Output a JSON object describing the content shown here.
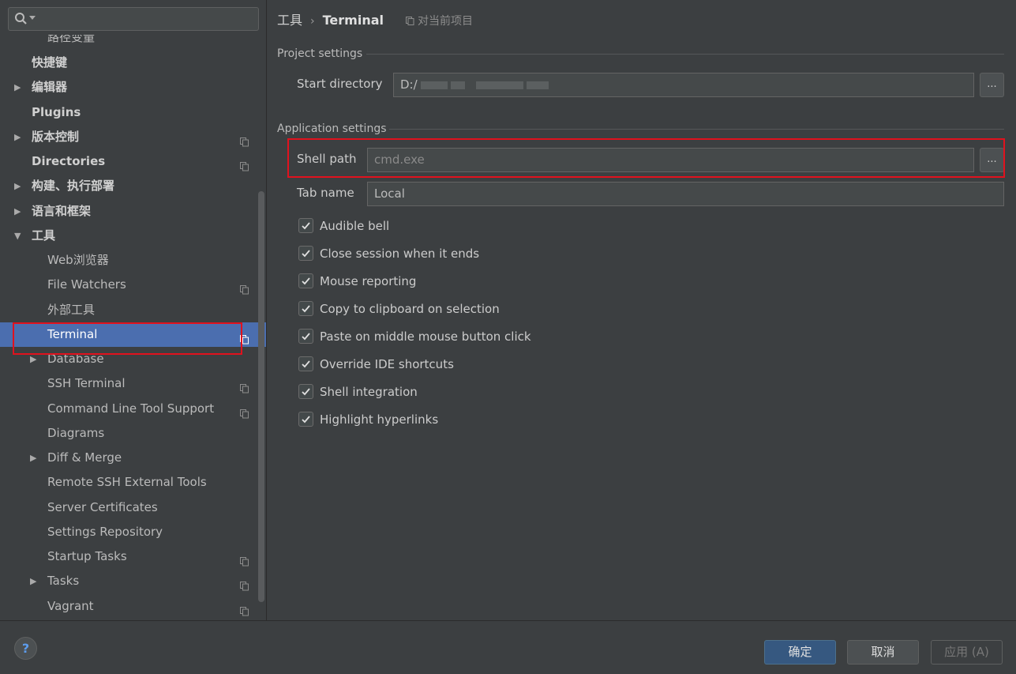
{
  "colors": {
    "background": "#3c3f41",
    "selection": "#4b6eaf",
    "highlight_box": "#e0121e",
    "primary_button": "#365880"
  },
  "sidebar": {
    "search": {
      "value": "",
      "icon": "search-icon"
    },
    "cut_item_label": "路径变量",
    "items": [
      {
        "label": "快捷键",
        "bold": true,
        "level": 0,
        "expandable": false,
        "project_icon": false
      },
      {
        "label": "编辑器",
        "bold": true,
        "level": 0,
        "expandable": true,
        "expanded": false,
        "project_icon": false
      },
      {
        "label": "Plugins",
        "bold": true,
        "level": 0,
        "expandable": false,
        "project_icon": false
      },
      {
        "label": "版本控制",
        "bold": true,
        "level": 0,
        "expandable": true,
        "expanded": false,
        "project_icon": true
      },
      {
        "label": "Directories",
        "bold": true,
        "level": 0,
        "expandable": false,
        "project_icon": true
      },
      {
        "label": "构建、执行部署",
        "bold": true,
        "level": 0,
        "expandable": true,
        "expanded": false,
        "project_icon": false
      },
      {
        "label": "语言和框架",
        "bold": true,
        "level": 0,
        "expandable": true,
        "expanded": false,
        "project_icon": false
      },
      {
        "label": "工具",
        "bold": true,
        "level": 0,
        "expandable": true,
        "expanded": true,
        "project_icon": false
      },
      {
        "label": "Web浏览器",
        "bold": false,
        "level": 1,
        "expandable": false,
        "project_icon": false
      },
      {
        "label": "File Watchers",
        "bold": false,
        "level": 1,
        "expandable": false,
        "project_icon": true
      },
      {
        "label": "外部工具",
        "bold": false,
        "level": 1,
        "expandable": false,
        "project_icon": false
      },
      {
        "label": "Terminal",
        "bold": false,
        "level": 1,
        "expandable": false,
        "project_icon": true,
        "selected": true
      },
      {
        "label": "Database",
        "bold": false,
        "level": 1,
        "expandable": true,
        "expanded": false,
        "project_icon": false
      },
      {
        "label": "SSH Terminal",
        "bold": false,
        "level": 1,
        "expandable": false,
        "project_icon": true
      },
      {
        "label": "Command Line Tool Support",
        "bold": false,
        "level": 1,
        "expandable": false,
        "project_icon": true
      },
      {
        "label": "Diagrams",
        "bold": false,
        "level": 1,
        "expandable": false,
        "project_icon": false
      },
      {
        "label": "Diff & Merge",
        "bold": false,
        "level": 1,
        "expandable": true,
        "expanded": false,
        "project_icon": false
      },
      {
        "label": "Remote SSH External Tools",
        "bold": false,
        "level": 1,
        "expandable": false,
        "project_icon": false
      },
      {
        "label": "Server Certificates",
        "bold": false,
        "level": 1,
        "expandable": false,
        "project_icon": false
      },
      {
        "label": "Settings Repository",
        "bold": false,
        "level": 1,
        "expandable": false,
        "project_icon": false
      },
      {
        "label": "Startup Tasks",
        "bold": false,
        "level": 1,
        "expandable": false,
        "project_icon": true
      },
      {
        "label": "Tasks",
        "bold": false,
        "level": 1,
        "expandable": true,
        "expanded": false,
        "project_icon": true
      },
      {
        "label": "Vagrant",
        "bold": false,
        "level": 1,
        "expandable": false,
        "project_icon": true
      }
    ]
  },
  "breadcrumb": {
    "parent": "工具",
    "separator": "›",
    "current": "Terminal",
    "scope_label": "对当前项目",
    "scope_icon": "project-scope-icon"
  },
  "project_settings": {
    "title": "Project settings",
    "start_directory": {
      "label": "Start directory",
      "value": "D:/",
      "browse": "..."
    }
  },
  "application_settings": {
    "title": "Application settings",
    "shell_path": {
      "label": "Shell path",
      "placeholder": "cmd.exe",
      "value": "",
      "browse": "..."
    },
    "tab_name": {
      "label": "Tab name",
      "value": "Local"
    },
    "checkboxes": [
      {
        "label": "Audible bell",
        "checked": true
      },
      {
        "label": "Close session when it ends",
        "checked": true
      },
      {
        "label": "Mouse reporting",
        "checked": true
      },
      {
        "label": "Copy to clipboard on selection",
        "checked": true
      },
      {
        "label": "Paste on middle mouse button click",
        "checked": true
      },
      {
        "label": "Override IDE shortcuts",
        "checked": true
      },
      {
        "label": "Shell integration",
        "checked": true
      },
      {
        "label": "Highlight hyperlinks",
        "checked": true
      }
    ]
  },
  "footer": {
    "help": "?",
    "ok": "确定",
    "cancel": "取消",
    "apply": "应用 (A)"
  }
}
